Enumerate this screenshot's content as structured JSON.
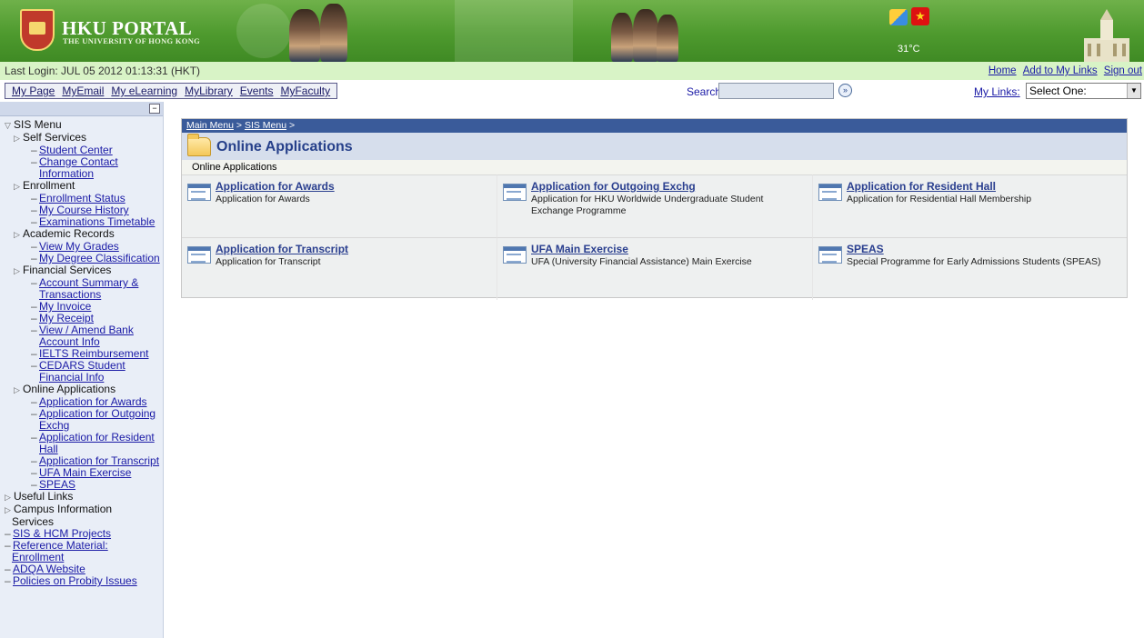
{
  "banner": {
    "title": "HKU PORTAL",
    "subtitle": "THE UNIVERSITY OF HONG KONG",
    "temperature": "31°C"
  },
  "login": {
    "last_login": "Last Login: JUL 05 2012 01:13:31 (HKT)",
    "links": [
      "Home",
      "Add to My Links",
      "Sign out"
    ]
  },
  "nav": {
    "tabs": [
      "My Page",
      "MyEmail",
      "My eLearning",
      "MyLibrary",
      "Events",
      "MyFaculty"
    ],
    "search_label": "Search:",
    "search_value": "",
    "mylinks_label": "My Links:",
    "mylinks_selected": "Select One:"
  },
  "sidebar": {
    "sis_menu": "SIS Menu",
    "self_services": "Self Services",
    "student_center": "Student Center",
    "change_contact_1": "Change Contact",
    "change_contact_2": "Information",
    "enrollment": "Enrollment",
    "enrollment_status": "Enrollment Status",
    "course_history": "My Course History",
    "exam_timetable": "Examinations Timetable",
    "academic_records": "Academic Records",
    "view_grades": "View My Grades",
    "degree_class": "My Degree Classification",
    "financial_services": "Financial Services",
    "acct_summary_1": "Account Summary &",
    "acct_summary_2": "Transactions",
    "invoice": "My Invoice",
    "receipt": "My Receipt",
    "bank_1": "View / Amend Bank",
    "bank_2": "Account Info",
    "ielts": "IELTS Reimbursement",
    "cedars_1": "CEDARS Student",
    "cedars_2": "Financial Info",
    "online_apps": "Online Applications",
    "app_awards": "Application for Awards",
    "app_exch_1": "Application for Outgoing",
    "app_exch_2": "Exchg",
    "app_hall_1": "Application for Resident",
    "app_hall_2": "Hall",
    "app_transcript": "Application for Transcript",
    "ufa": "UFA Main Exercise",
    "speas": "SPEAS",
    "useful_links": "Useful Links",
    "campus_info_1": "Campus Information",
    "campus_info_2": "Services",
    "sis_hcm": "SIS & HCM Projects",
    "ref_mat_1": "Reference Material:",
    "ref_mat_2": "Enrollment",
    "adqa": "ADQA Website",
    "probity": "Policies on Probity Issues"
  },
  "main": {
    "breadcrumb": [
      "Main Menu",
      "SIS Menu"
    ],
    "title": "Online Applications",
    "subtitle": "Online Applications",
    "cards": [
      {
        "title": "Application for Awards",
        "desc": "Application for Awards"
      },
      {
        "title": "Application for Outgoing Exchg",
        "desc": "Application for HKU Worldwide Undergraduate Student Exchange Programme"
      },
      {
        "title": "Application for Resident Hall",
        "desc": "Application for Residential Hall Membership"
      },
      {
        "title": "Application for Transcript",
        "desc": "Application for Transcript"
      },
      {
        "title": "UFA Main Exercise",
        "desc": "UFA (University Financial Assistance) Main Exercise"
      },
      {
        "title": "SPEAS",
        "desc": "Special Programme for Early Admissions Students (SPEAS)"
      }
    ]
  }
}
